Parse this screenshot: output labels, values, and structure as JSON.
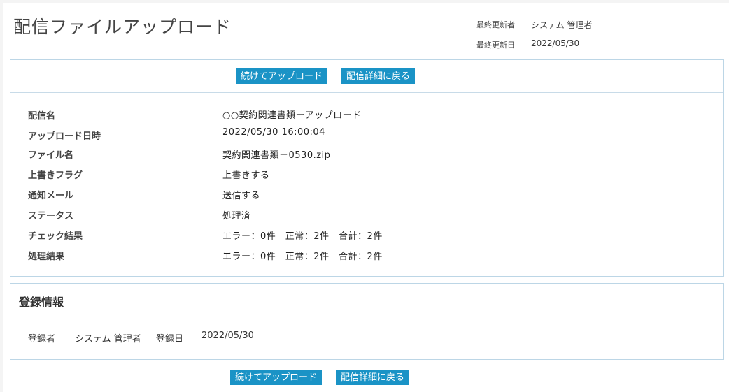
{
  "header": {
    "title": "配信ファイルアップロード",
    "updated_by_label": "最終更新者",
    "updated_by_value": "システム 管理者",
    "updated_date_label": "最終更新日",
    "updated_date_value": "2022/05/30"
  },
  "actions": {
    "continue_upload": "続けてアップロード",
    "back_to_detail": "配信詳細に戻る"
  },
  "details": {
    "rows": [
      {
        "label": "配信名",
        "value": "○○契約関連書類ーアップロード"
      },
      {
        "label": "アップロード日時",
        "value": "2022/05/30 16:00:04"
      },
      {
        "label": "ファイル名",
        "value": "契約関連書類－0530.zip"
      },
      {
        "label": "上書きフラグ",
        "value": "上書きする"
      },
      {
        "label": "通知メール",
        "value": "送信する"
      },
      {
        "label": "ステータス",
        "value": "処理済"
      },
      {
        "label": "チェック結果",
        "value": "エラー：0件　正常：2件　合計：2件"
      },
      {
        "label": "処理結果",
        "value": "エラー：0件　正常：2件　合計：2件"
      }
    ]
  },
  "registration": {
    "title": "登録情報",
    "registrant_label": "登録者",
    "registrant_value": "システム 管理者",
    "date_label": "登録日",
    "date_value": "2022/05/30"
  },
  "colors": {
    "accent": "#1a93c6",
    "border": "#bcd6e6"
  }
}
